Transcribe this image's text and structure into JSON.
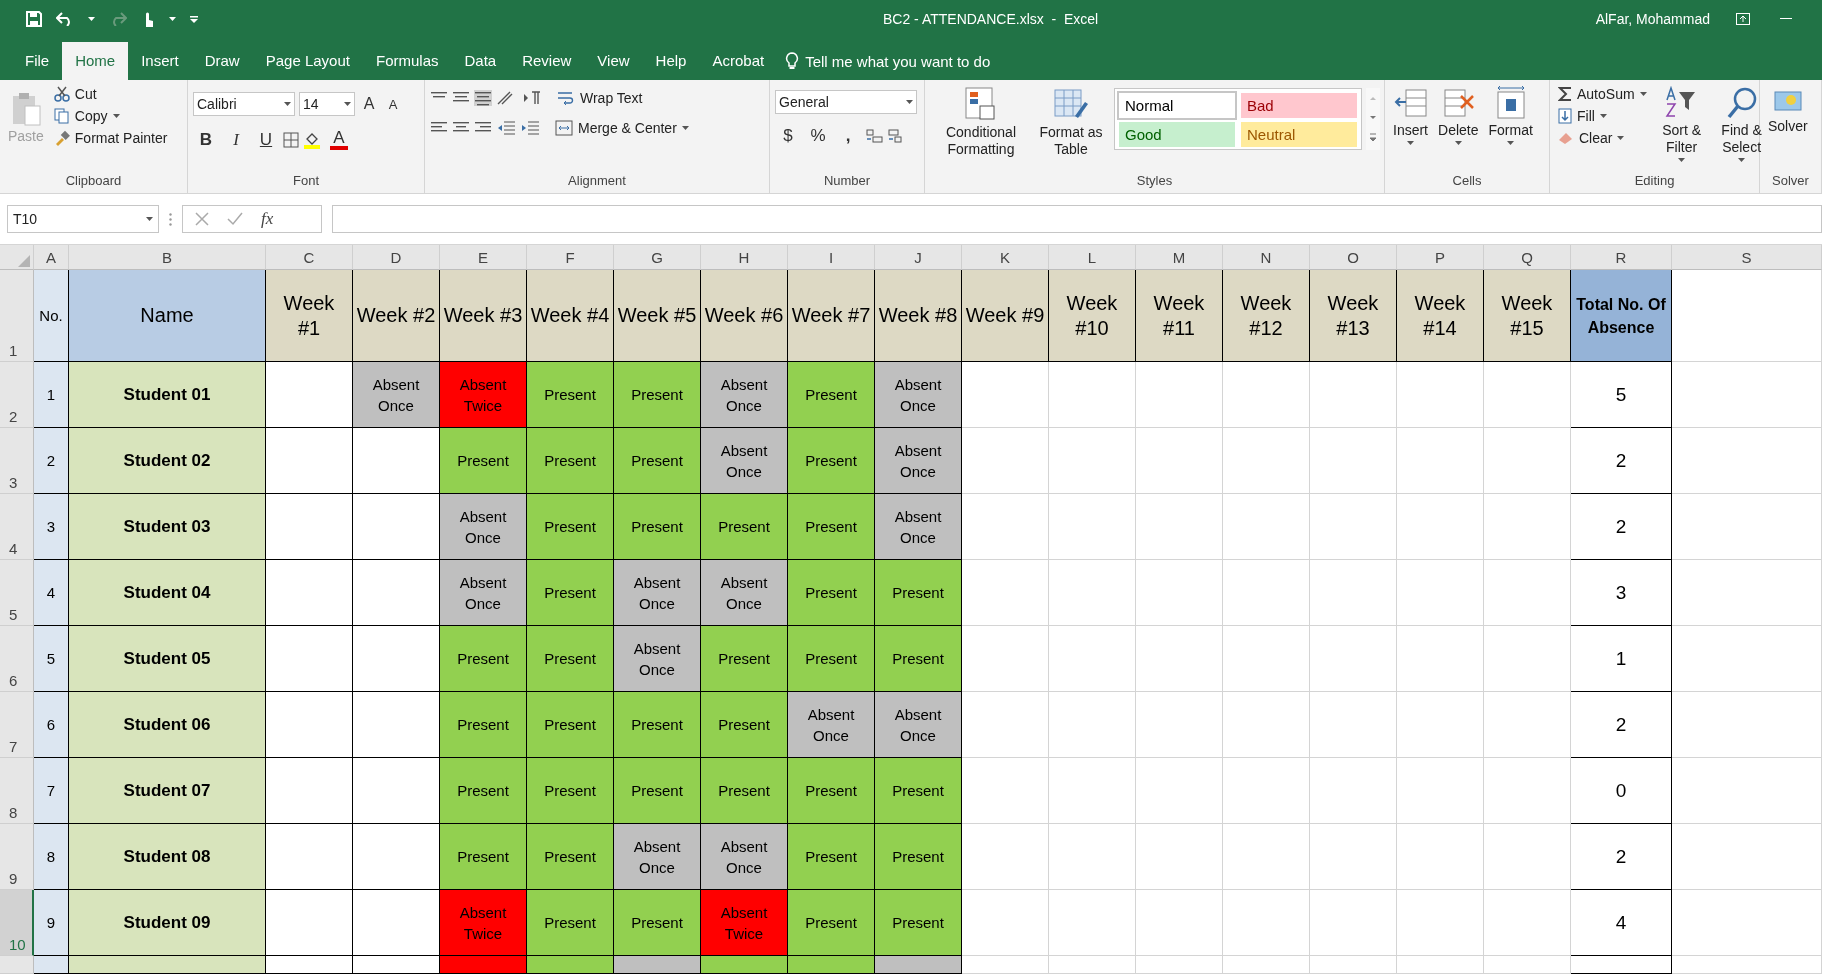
{
  "title_bar": {
    "title": "BC2 - ATTENDANCE.xlsx  -  Excel",
    "user": "AlFar, Mohammad"
  },
  "ribbon_tabs": [
    {
      "label": "File",
      "selected": false
    },
    {
      "label": "Home",
      "selected": true
    },
    {
      "label": "Insert",
      "selected": false
    },
    {
      "label": "Draw",
      "selected": false
    },
    {
      "label": "Page Layout",
      "selected": false
    },
    {
      "label": "Formulas",
      "selected": false
    },
    {
      "label": "Data",
      "selected": false
    },
    {
      "label": "Review",
      "selected": false
    },
    {
      "label": "View",
      "selected": false
    },
    {
      "label": "Help",
      "selected": false
    },
    {
      "label": "Acrobat",
      "selected": false
    }
  ],
  "tell_me": "Tell me what you want to do",
  "ribbon": {
    "clipboard": {
      "paste": {
        "label": "Paste",
        "disabled": true
      },
      "cut": "Cut",
      "copy": "Copy",
      "format_painter": "Format Painter",
      "label": "Clipboard"
    },
    "font": {
      "font_name": "Calibri",
      "font_size": "14",
      "grow": "A",
      "shrink": "A",
      "bold": "B",
      "italic": "I",
      "underline": "U",
      "font_color": "A",
      "label": "Font"
    },
    "alignment": {
      "wrap_text": "Wrap Text",
      "merge_center": "Merge & Center",
      "label": "Alignment"
    },
    "number": {
      "format": "General",
      "currency": "$",
      "percent": "%",
      "comma": ",",
      "label": "Number"
    },
    "styles": {
      "conditional": "Conditional Formatting",
      "format_table": "Format as Table",
      "gallery": [
        {
          "label": "Normal",
          "kind": "normal"
        },
        {
          "label": "Bad",
          "kind": "bad"
        },
        {
          "label": "Good",
          "kind": "good"
        },
        {
          "label": "Neutral",
          "kind": "neutral"
        }
      ],
      "label": "Styles"
    },
    "cells": {
      "buttons": [
        "Insert",
        "Delete",
        "Format"
      ],
      "label": "Cells"
    },
    "editing": {
      "autosum": "AutoSum",
      "fill": "Fill",
      "clear": "Clear",
      "sort": "Sort & Filter",
      "find": "Find & Select",
      "label": "Editing"
    },
    "solver": {
      "button": "Solver",
      "label": "Solver"
    }
  },
  "formula_bar": {
    "name_box": "T10",
    "fx": "fx"
  },
  "sheet": {
    "column_headers": [
      "A",
      "B",
      "C",
      "D",
      "E",
      "F",
      "G",
      "H",
      "I",
      "J",
      "K",
      "L",
      "M",
      "N",
      "O",
      "P",
      "Q",
      "R",
      "S"
    ],
    "row_headers": [
      {
        "label": "1",
        "selected": false
      },
      {
        "label": "2",
        "selected": false
      },
      {
        "label": "3",
        "selected": false
      },
      {
        "label": "4",
        "selected": false
      },
      {
        "label": "5",
        "selected": false
      },
      {
        "label": "6",
        "selected": false
      },
      {
        "label": "7",
        "selected": false
      },
      {
        "label": "8",
        "selected": false
      },
      {
        "label": "9",
        "selected": false
      },
      {
        "label": "10",
        "selected": true
      }
    ],
    "header": {
      "no": "No.",
      "name": "Name",
      "weeks": [
        "Week #1",
        "Week #2",
        "Week #3",
        "Week #4",
        "Week #5",
        "Week #6",
        "Week #7",
        "Week #8",
        "Week #9",
        "Week #10",
        "Week #11",
        "Week #12",
        "Week #13",
        "Week #14",
        "Week #15"
      ],
      "total": "Total No. Of Absence"
    },
    "rows": [
      {
        "no": "1",
        "name": "Student 01",
        "total": "5",
        "weeks": [
          {
            "kind": "empty"
          },
          {
            "kind": "once",
            "text": "Absent Once"
          },
          {
            "kind": "twice",
            "text": "Absent Twice"
          },
          {
            "kind": "present",
            "text": "Present"
          },
          {
            "kind": "present",
            "text": "Present"
          },
          {
            "kind": "once",
            "text": "Absent Once"
          },
          {
            "kind": "present",
            "text": "Present"
          },
          {
            "kind": "once",
            "text": "Absent Once"
          }
        ]
      },
      {
        "no": "2",
        "name": "Student 02",
        "total": "2",
        "weeks": [
          {
            "kind": "empty"
          },
          {
            "kind": "empty"
          },
          {
            "kind": "present",
            "text": "Present"
          },
          {
            "kind": "present",
            "text": "Present"
          },
          {
            "kind": "present",
            "text": "Present"
          },
          {
            "kind": "once",
            "text": "Absent Once"
          },
          {
            "kind": "present",
            "text": "Present"
          },
          {
            "kind": "once",
            "text": "Absent Once"
          }
        ]
      },
      {
        "no": "3",
        "name": "Student 03",
        "total": "2",
        "weeks": [
          {
            "kind": "empty"
          },
          {
            "kind": "empty"
          },
          {
            "kind": "once",
            "text": "Absent Once"
          },
          {
            "kind": "present",
            "text": "Present"
          },
          {
            "kind": "present",
            "text": "Present"
          },
          {
            "kind": "present",
            "text": "Present"
          },
          {
            "kind": "present",
            "text": "Present"
          },
          {
            "kind": "once",
            "text": "Absent Once"
          }
        ]
      },
      {
        "no": "4",
        "name": "Student 04",
        "total": "3",
        "weeks": [
          {
            "kind": "empty"
          },
          {
            "kind": "empty"
          },
          {
            "kind": "once",
            "text": "Absent Once"
          },
          {
            "kind": "present",
            "text": "Present"
          },
          {
            "kind": "once",
            "text": "Absent Once"
          },
          {
            "kind": "once",
            "text": "Absent Once"
          },
          {
            "kind": "present",
            "text": "Present"
          },
          {
            "kind": "present",
            "text": "Present"
          }
        ]
      },
      {
        "no": "5",
        "name": "Student 05",
        "total": "1",
        "weeks": [
          {
            "kind": "empty"
          },
          {
            "kind": "empty"
          },
          {
            "kind": "present",
            "text": "Present"
          },
          {
            "kind": "present",
            "text": "Present"
          },
          {
            "kind": "once",
            "text": "Absent Once"
          },
          {
            "kind": "present",
            "text": "Present"
          },
          {
            "kind": "present",
            "text": "Present"
          },
          {
            "kind": "present",
            "text": "Present"
          }
        ]
      },
      {
        "no": "6",
        "name": "Student 06",
        "total": "2",
        "weeks": [
          {
            "kind": "empty"
          },
          {
            "kind": "empty"
          },
          {
            "kind": "present",
            "text": "Present"
          },
          {
            "kind": "present",
            "text": "Present"
          },
          {
            "kind": "present",
            "text": "Present"
          },
          {
            "kind": "present",
            "text": "Present"
          },
          {
            "kind": "once",
            "text": "Absent Once"
          },
          {
            "kind": "once",
            "text": "Absent Once"
          }
        ]
      },
      {
        "no": "7",
        "name": "Student 07",
        "total": "0",
        "weeks": [
          {
            "kind": "empty"
          },
          {
            "kind": "empty"
          },
          {
            "kind": "present",
            "text": "Present"
          },
          {
            "kind": "present",
            "text": "Present"
          },
          {
            "kind": "present",
            "text": "Present"
          },
          {
            "kind": "present",
            "text": "Present"
          },
          {
            "kind": "present",
            "text": "Present"
          },
          {
            "kind": "present",
            "text": "Present"
          }
        ]
      },
      {
        "no": "8",
        "name": "Student 08",
        "total": "2",
        "weeks": [
          {
            "kind": "empty"
          },
          {
            "kind": "empty"
          },
          {
            "kind": "present",
            "text": "Present"
          },
          {
            "kind": "present",
            "text": "Present"
          },
          {
            "kind": "once",
            "text": "Absent Once"
          },
          {
            "kind": "once",
            "text": "Absent Once"
          },
          {
            "kind": "present",
            "text": "Present"
          },
          {
            "kind": "present",
            "text": "Present"
          }
        ]
      },
      {
        "no": "9",
        "name": "Student 09",
        "total": "4",
        "weeks": [
          {
            "kind": "empty"
          },
          {
            "kind": "empty"
          },
          {
            "kind": "twice",
            "text": "Absent Twice"
          },
          {
            "kind": "present",
            "text": "Present"
          },
          {
            "kind": "present",
            "text": "Present"
          },
          {
            "kind": "twice",
            "text": "Absent Twice"
          },
          {
            "kind": "present",
            "text": "Present"
          },
          {
            "kind": "present",
            "text": "Present"
          }
        ]
      }
    ],
    "partial_row": {
      "weeks": [
        {
          "kind": "empty"
        },
        {
          "kind": "empty"
        },
        {
          "kind": "twice"
        },
        {
          "kind": "present"
        },
        {
          "kind": "once"
        },
        {
          "kind": "present"
        },
        {
          "kind": "present"
        },
        {
          "kind": "once"
        }
      ]
    }
  }
}
